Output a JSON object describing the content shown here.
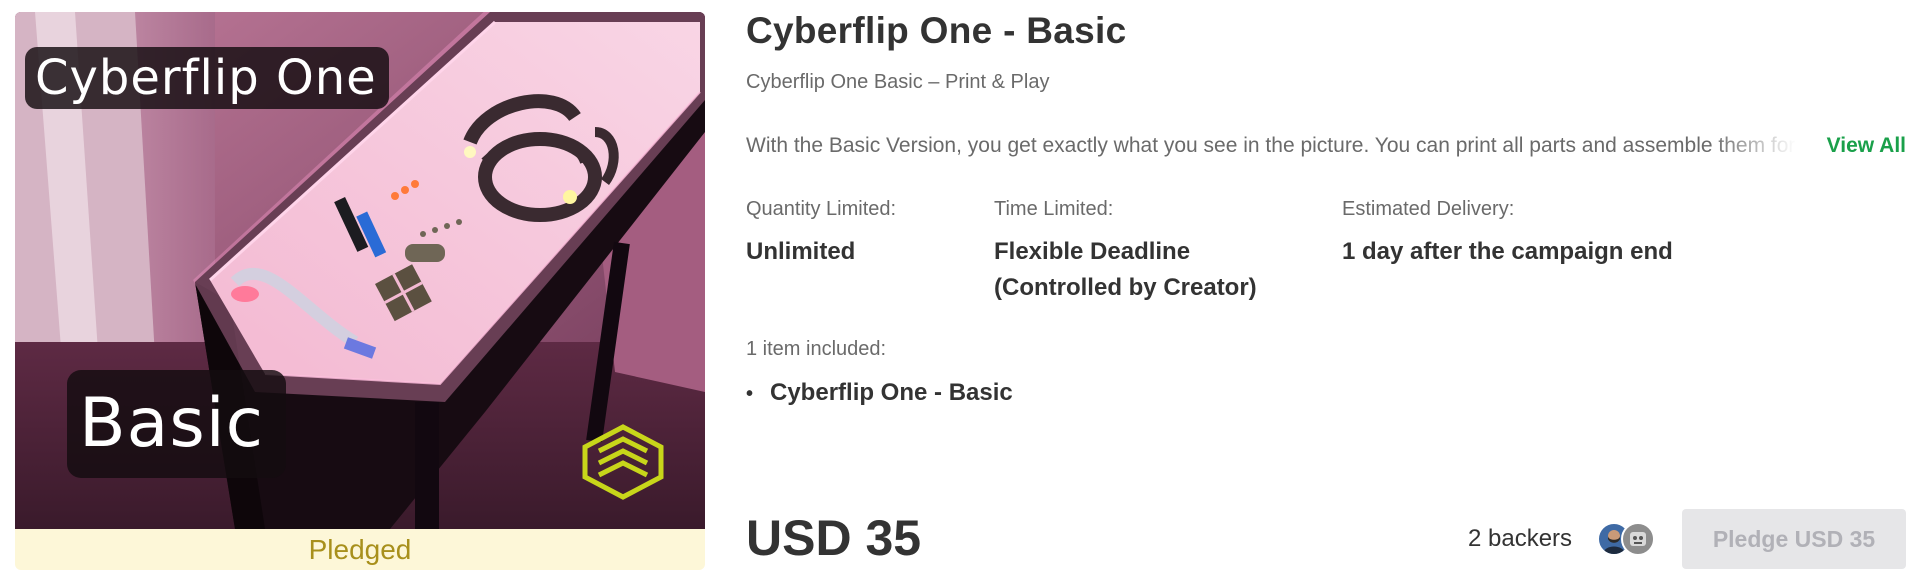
{
  "reward": {
    "image": {
      "overlay_top": "Cyberflip One",
      "overlay_bottom": "Basic",
      "status_label": "Pledged"
    },
    "title": "Cyberflip One - Basic",
    "subtitle": "Cyberflip One Basic – Print & Play",
    "description": "With the Basic Version, you get exactly what you see in the picture. You can print all parts and assemble them for",
    "view_all_label": "View All",
    "meta": [
      {
        "label": "Quantity Limited:",
        "value": "Unlimited"
      },
      {
        "label": "Time Limited:",
        "value": "Flexible Deadline\n(Controlled by Creator)"
      },
      {
        "label": "Estimated Delivery:",
        "value": "1 day after the campaign end"
      }
    ],
    "items_included_label": "1 item included:",
    "items": [
      "Cyberflip One - Basic"
    ],
    "price": "USD 35",
    "backers_label": "2 backers",
    "pledge_button_label": "Pledge USD 35"
  },
  "colors": {
    "accent_green": "#1aa04a",
    "pledged_bg": "#fdf7d8",
    "pledged_text": "#a8901c",
    "button_disabled_bg": "#e6e6e8",
    "button_disabled_text": "#b1b1b7"
  }
}
